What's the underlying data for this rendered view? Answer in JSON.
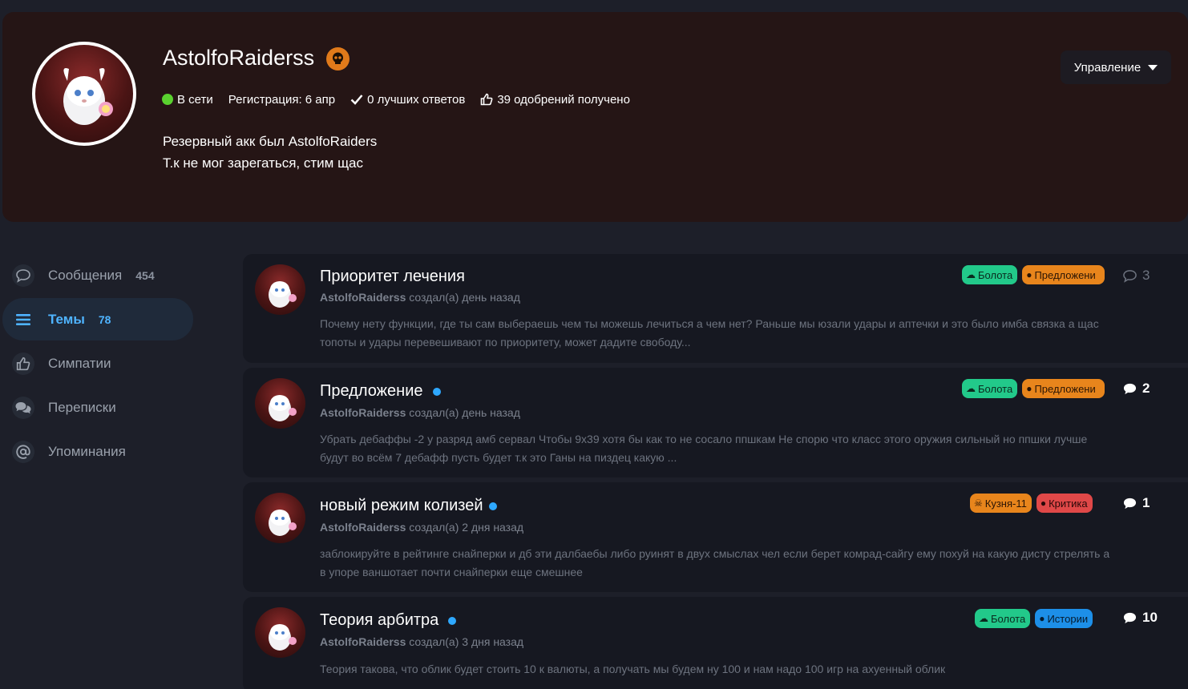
{
  "profile": {
    "username": "AstolfoRaiderss",
    "badge_icon": "skull-icon",
    "online_label": "В сети",
    "registration": "Регистрация: 6 апр",
    "best_answers": "0 лучших ответов",
    "likes_received": "39 одобрений получено",
    "bio_line1": "Резервный акк был AstolfoRaiders",
    "bio_line2": "Т.к не мог зарегаться, стим щас",
    "manage_label": "Управление"
  },
  "sidebar": {
    "items": [
      {
        "label": "Сообщения",
        "count": "454",
        "icon": "speech-bubble-icon"
      },
      {
        "label": "Темы",
        "count": "78",
        "icon": "list-icon"
      },
      {
        "label": "Симпатии",
        "count": "",
        "icon": "thumbs-up-icon"
      },
      {
        "label": "Переписки",
        "count": "",
        "icon": "chats-icon"
      },
      {
        "label": "Упоминания",
        "count": "",
        "icon": "at-icon"
      }
    ]
  },
  "topics": [
    {
      "title": "Приоритет лечения",
      "author": "AstolfoRaiderss",
      "meta": "создал(а) день назад",
      "excerpt": "Почему нету функции, где ты сам выбераешь чем ты можешь лечиться а чем нет? Раньше мы юзали удары и аптечки и это было имба связка а щас топоты и удары перевешивают по приоритету, может дадите свободу...",
      "tags": [
        {
          "label": "Болота",
          "color": "#22c98a"
        },
        {
          "label": "Предложени",
          "color": "#e8851c"
        }
      ],
      "replies": "3"
    },
    {
      "title": "Предложение",
      "author": "AstolfoRaiderss",
      "meta": "создал(а) день назад",
      "excerpt": "Убрать дебаффы -2 у разряд амб сервал Чтобы 9х39 хотя бы как то не сосало ппшкам Не спорю что класс этого оружия сильный но ппшки лучше будут во всём 7 дебафф пусть будет т.к это Ганы на пиздец какую ...",
      "tags": [
        {
          "label": "Болота",
          "color": "#22c98a"
        },
        {
          "label": "Предложени",
          "color": "#e8851c"
        }
      ],
      "replies": "2"
    },
    {
      "title": "новый режим колизей",
      "author": "AstolfoRaiderss",
      "meta": "создал(а) 2 дня назад",
      "excerpt": "заблокируйте в рейтинге снайперки и дб эти далбаебы либо руинят в двух смыслах чел если берет комрад-сайгу ему похуй на какую дисту стрелять а в упоре ваншотает почти снайперки еще смешнее",
      "tags": [
        {
          "label": "Кузня-11",
          "color": "#e8851c"
        },
        {
          "label": "Критика",
          "color": "#e04848"
        }
      ],
      "replies": "1"
    },
    {
      "title": "Теория арбитра",
      "author": "AstolfoRaiderss",
      "meta": "создал(а) 3 дня назад",
      "excerpt": "Теория такова, что облик будет стоить 10 к валюты, а получать мы будем ну 100 и нам надо 100 игр на ахуенный облик",
      "tags": [
        {
          "label": "Болота",
          "color": "#22c98a"
        },
        {
          "label": "Истории",
          "color": "#1d8fe8"
        }
      ],
      "replies": "10"
    }
  ]
}
